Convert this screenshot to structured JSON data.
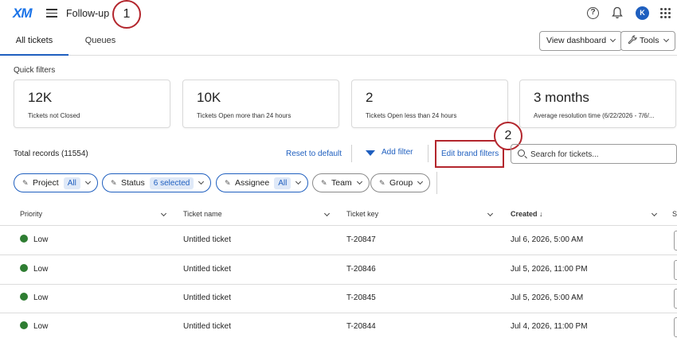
{
  "topbar": {
    "logo": "XM",
    "title": "Follow-up",
    "avatar_initial": "K",
    "help_glyph": "?"
  },
  "annotations": {
    "step1": "1",
    "step2": "2"
  },
  "tabs": [
    {
      "label": "All tickets",
      "active": true
    },
    {
      "label": "Queues",
      "active": false
    }
  ],
  "buttons": {
    "view_dashboard": "View dashboard",
    "tools": "Tools"
  },
  "quick_filters": {
    "label": "Quick filters",
    "cards": [
      {
        "value": "12K",
        "desc": "Tickets not Closed"
      },
      {
        "value": "10K",
        "desc": "Tickets Open more than 24 hours"
      },
      {
        "value": "2",
        "desc": "Tickets Open less than 24 hours"
      },
      {
        "value": "3 months",
        "desc": "Average resolution time (6/22/2026 - 7/6/..."
      }
    ]
  },
  "toolbar": {
    "total_records": "Total records (11554)",
    "reset": "Reset to default",
    "add_filter": "Add filter",
    "edit_brand_filters": "Edit brand filters",
    "search_placeholder": "Search for tickets..."
  },
  "chips": [
    {
      "label": "Project",
      "badge": "All"
    },
    {
      "label": "Status",
      "badge": "6 selected"
    },
    {
      "label": "Assignee",
      "badge": "All"
    },
    {
      "label": "Team",
      "badge": ""
    },
    {
      "label": "Group",
      "badge": ""
    }
  ],
  "table": {
    "columns": [
      "Priority",
      "Ticket name",
      "Ticket key",
      "Created",
      "S"
    ],
    "sort_glyph": "↓",
    "rows": [
      {
        "priority": "Low",
        "name": "Untitled ticket",
        "key": "T-20847",
        "created": "Jul 6, 2026, 5:00 AM"
      },
      {
        "priority": "Low",
        "name": "Untitled ticket",
        "key": "T-20846",
        "created": "Jul 5, 2026, 11:00 PM"
      },
      {
        "priority": "Low",
        "name": "Untitled ticket",
        "key": "T-20845",
        "created": "Jul 5, 2026, 5:00 AM"
      },
      {
        "priority": "Low",
        "name": "Untitled ticket",
        "key": "T-20844",
        "created": "Jul 4, 2026, 11:00 PM"
      }
    ]
  },
  "colors": {
    "accent": "#1f5fbf",
    "annotation": "#b3262d",
    "status_low": "#2e7d32"
  }
}
